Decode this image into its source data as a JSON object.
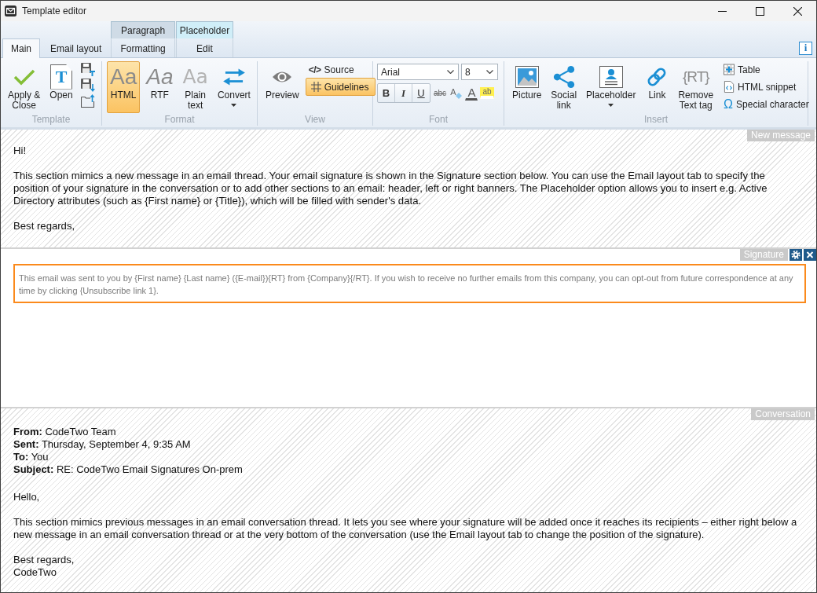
{
  "window": {
    "title": "Template editor"
  },
  "ribbon_tabs": [
    {
      "label": "Main",
      "selected": true
    },
    {
      "label": "Email layout",
      "selected": false
    }
  ],
  "contextual_tab_groups": [
    {
      "label": "Paragraph",
      "color": "#cfdbe6",
      "tabs": [
        {
          "label": "Formatting",
          "selected": false
        }
      ]
    },
    {
      "label": "Placeholder",
      "color": "#d0eef8",
      "tabs": [
        {
          "label": "Edit",
          "selected": false
        }
      ]
    }
  ],
  "info_button": {
    "glyph": "i"
  },
  "ribbon": {
    "template_group": {
      "label": "Template",
      "apply_close": {
        "label": "Apply &\nClose"
      },
      "open": {
        "label": "Open",
        "icon_glyph": "T"
      }
    },
    "format_group": {
      "label": "Format",
      "formats": [
        {
          "kind": "html",
          "label": "HTML",
          "icon_glyph": "Aa",
          "selected": true
        },
        {
          "kind": "rtf",
          "label": "RTF",
          "icon_glyph": "Aa",
          "selected": false
        },
        {
          "kind": "plain",
          "label": "Plain\ntext",
          "icon_glyph": "Aa",
          "selected": false
        }
      ],
      "convert": {
        "label": "Convert"
      }
    },
    "view_group": {
      "label": "View",
      "preview": {
        "label": "Preview"
      },
      "source": {
        "label": "Source",
        "icon_glyph": "</>"
      },
      "guidelines": {
        "label": "Guidelines",
        "on": true
      }
    },
    "font_group": {
      "label": "Font",
      "font_name": {
        "value": "Arial"
      },
      "font_size": {
        "value": "8"
      },
      "style_buttons": [
        {
          "kind": "bold",
          "label": "B"
        },
        {
          "kind": "italic",
          "label": "I"
        },
        {
          "kind": "underline",
          "label": "U"
        }
      ],
      "strikethrough": {
        "label": "abc"
      },
      "clear_format": {
        "glyph": "A"
      },
      "font_color": {
        "label": "A"
      },
      "highlight": {
        "label": "ab"
      }
    },
    "insert_group": {
      "label": "Insert",
      "large_buttons": [
        {
          "kind": "picture",
          "label": "Picture"
        },
        {
          "kind": "social",
          "label": "Social\nlink"
        },
        {
          "kind": "placeholder",
          "label": "Placeholder"
        },
        {
          "kind": "link",
          "label": "Link"
        },
        {
          "kind": "text_tag",
          "label": "Remove\nText tag",
          "icon_glyph": "{RT}"
        }
      ],
      "small_buttons": [
        {
          "kind": "table",
          "label": "Table"
        },
        {
          "kind": "snippet",
          "label": "HTML snippet"
        },
        {
          "kind": "special_character",
          "label": "Special character",
          "icon_glyph": "Ω"
        }
      ]
    }
  },
  "new_message": {
    "label": "New message",
    "paragraphs": [
      "Hi!",
      "This section mimics a new message in an email thread. Your email signature is shown in the Signature section below. You can use the Email layout tab to specify the position of your signature in the conversation or to add other sections to an email: header, left or right banners. The Placeholder option allows you to insert e.g. Active Directory attributes (such as {First name} or {Title}), which will be filled with sender's data.",
      "Best regards,"
    ]
  },
  "signature": {
    "label": "Signature",
    "text": "This email was sent to you by {First name} {Last name} ({E-mail}){RT} from {Company}{/RT}. If you wish to receive no further emails from this company, you can opt-out from future correspondence at any time by clicking {Unsubscribe link 1}."
  },
  "conversation": {
    "label": "Conversation",
    "headers": [
      "**From:** CodeTwo Team",
      "**Sent:** Thursday, September 4, 9:35 AM",
      "**To:** You",
      "**Subject:** RE: CodeTwo Email Signatures On-prem"
    ],
    "paragraphs": [
      "Hello,",
      "This section mimics previous messages in an email conversation thread. It lets you see where your signature will be added once it reaches its recipients – either right below a new message in an email conversation thread or at the very bottom of the conversation (use the Email layout tab to change the position of the signature)."
    ],
    "closing": [
      "Best regards,",
      "CodeTwo"
    ]
  }
}
